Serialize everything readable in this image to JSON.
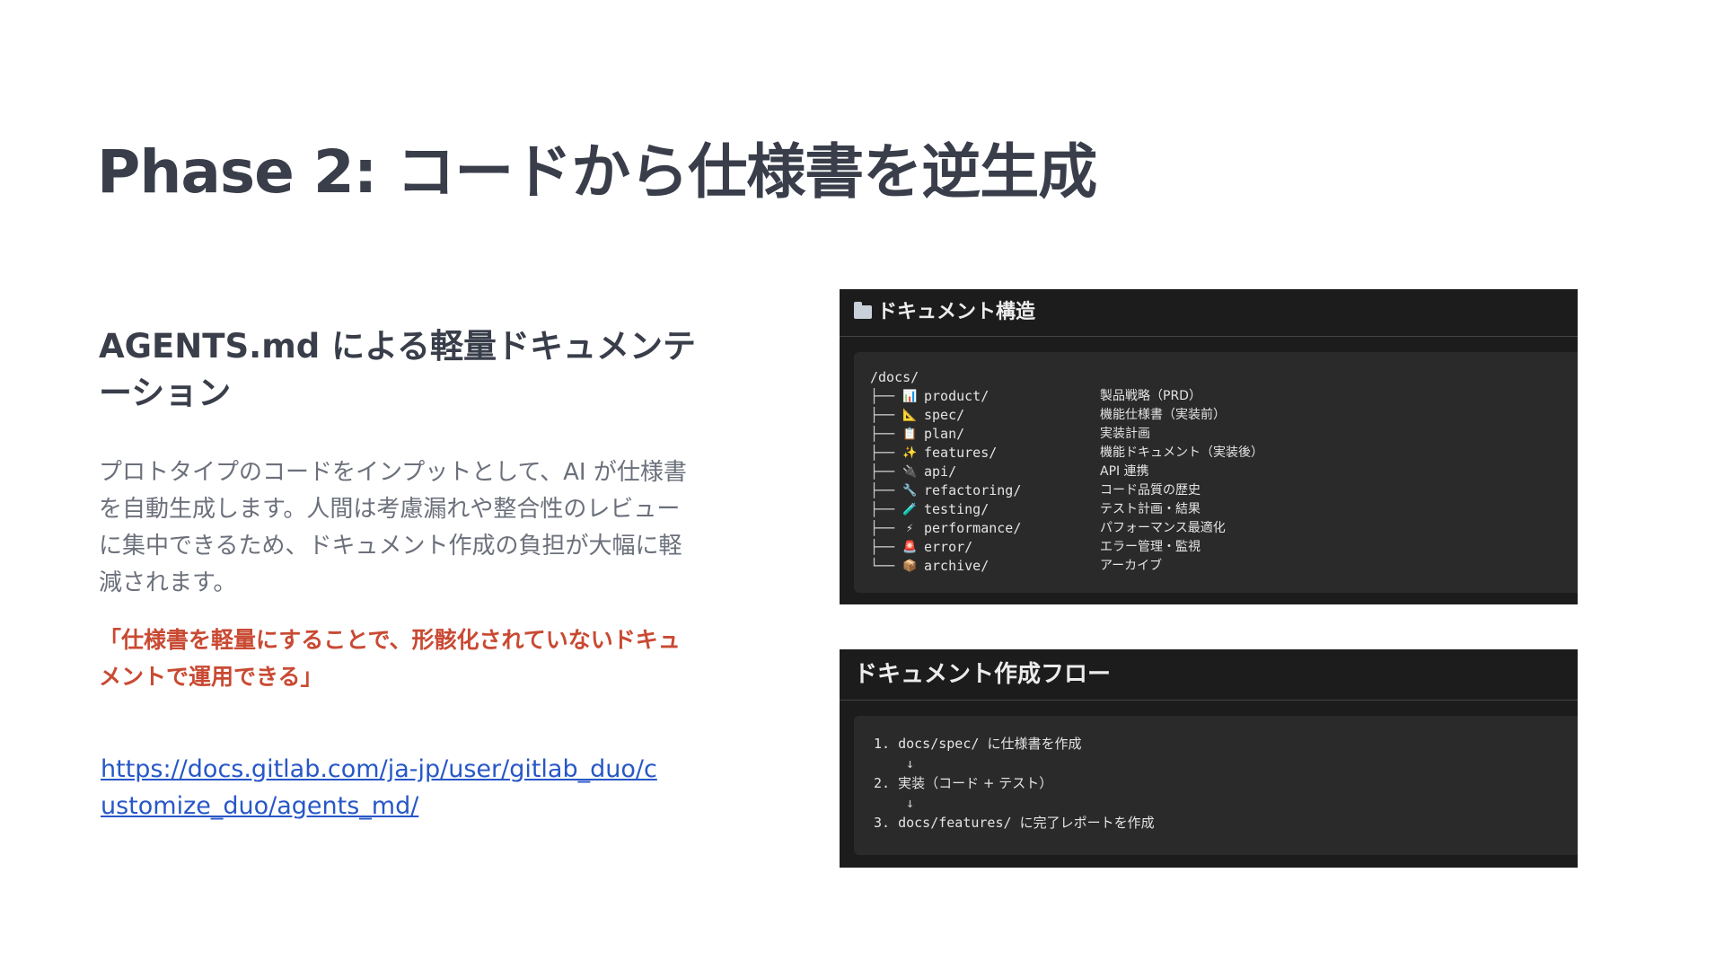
{
  "title": "Phase 2: コードから仕様書を逆生成",
  "left": {
    "subtitle": "AGENTS.md による軽量ドキュメンテーション",
    "body": "プロトタイプのコードをインプットとして、AI が仕様書を自動生成します。人間は考慮漏れや整合性のレビューに集中できるため、ドキュメント作成の負担が大幅に軽減されます。",
    "quote": "「仕様書を軽量にすることで、形骸化されていないドキュメントで運用できる」",
    "link": "https://docs.gitlab.com/ja-jp/user/gitlab_duo/customize_duo/agents_md/"
  },
  "docs_panel": {
    "heading_icon": "folder-icon",
    "heading": "ドキュメント構造",
    "root": "/docs/",
    "items": [
      {
        "branch": "├──",
        "icon": "📊",
        "icon_name": "chart-icon",
        "name": "product/",
        "desc": "製品戦略（PRD）"
      },
      {
        "branch": "├──",
        "icon": "📐",
        "icon_name": "ruler-icon",
        "name": "spec/",
        "desc": "機能仕様書（実装前）"
      },
      {
        "branch": "├──",
        "icon": "📋",
        "icon_name": "clipboard-icon",
        "name": "plan/",
        "desc": "実装計画"
      },
      {
        "branch": "├──",
        "icon": "✨",
        "icon_name": "sparkles-icon",
        "name": "features/",
        "desc": "機能ドキュメント（実装後）"
      },
      {
        "branch": "├──",
        "icon": "🔌",
        "icon_name": "plug-icon",
        "name": "api/",
        "desc": "API 連携"
      },
      {
        "branch": "├──",
        "icon": "🔧",
        "icon_name": "wrench-icon",
        "name": "refactoring/",
        "desc": "コード品質の歴史"
      },
      {
        "branch": "├──",
        "icon": "🧪",
        "icon_name": "test-tube-icon",
        "name": "testing/",
        "desc": "テスト計画・結果"
      },
      {
        "branch": "├──",
        "icon": "⚡",
        "icon_name": "lightning-icon",
        "name": "performance/",
        "desc": "パフォーマンス最適化"
      },
      {
        "branch": "├──",
        "icon": "🚨",
        "icon_name": "siren-icon",
        "name": "error/",
        "desc": "エラー管理・監視"
      },
      {
        "branch": "└──",
        "icon": "📦",
        "icon_name": "package-icon",
        "name": "archive/",
        "desc": "アーカイブ"
      }
    ]
  },
  "flow_panel": {
    "heading": "ドキュメント作成フロー",
    "arrow": "↓",
    "steps": [
      {
        "num": "1.",
        "path": "docs/spec/",
        "text": "に仕様書を作成"
      },
      {
        "num": "2.",
        "path": "",
        "text": "実装（コード + テスト）"
      },
      {
        "num": "3.",
        "path": "docs/features/",
        "text": "に完了レポートを作成"
      }
    ]
  }
}
